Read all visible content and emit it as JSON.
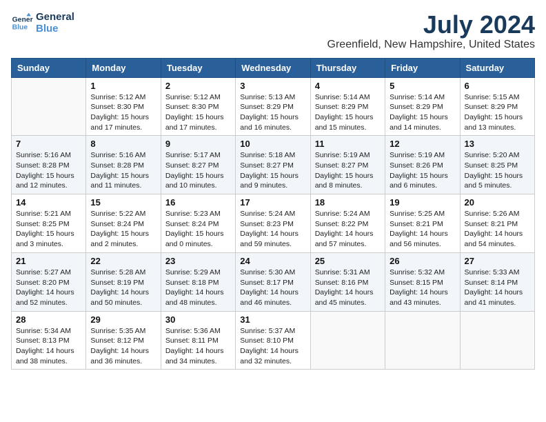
{
  "logo": {
    "line1": "General",
    "line2": "Blue"
  },
  "title": "July 2024",
  "subtitle": "Greenfield, New Hampshire, United States",
  "columns": [
    "Sunday",
    "Monday",
    "Tuesday",
    "Wednesday",
    "Thursday",
    "Friday",
    "Saturday"
  ],
  "weeks": [
    [
      {
        "day": "",
        "info": ""
      },
      {
        "day": "1",
        "info": "Sunrise: 5:12 AM\nSunset: 8:30 PM\nDaylight: 15 hours\nand 17 minutes."
      },
      {
        "day": "2",
        "info": "Sunrise: 5:12 AM\nSunset: 8:30 PM\nDaylight: 15 hours\nand 17 minutes."
      },
      {
        "day": "3",
        "info": "Sunrise: 5:13 AM\nSunset: 8:29 PM\nDaylight: 15 hours\nand 16 minutes."
      },
      {
        "day": "4",
        "info": "Sunrise: 5:14 AM\nSunset: 8:29 PM\nDaylight: 15 hours\nand 15 minutes."
      },
      {
        "day": "5",
        "info": "Sunrise: 5:14 AM\nSunset: 8:29 PM\nDaylight: 15 hours\nand 14 minutes."
      },
      {
        "day": "6",
        "info": "Sunrise: 5:15 AM\nSunset: 8:29 PM\nDaylight: 15 hours\nand 13 minutes."
      }
    ],
    [
      {
        "day": "7",
        "info": "Sunrise: 5:16 AM\nSunset: 8:28 PM\nDaylight: 15 hours\nand 12 minutes."
      },
      {
        "day": "8",
        "info": "Sunrise: 5:16 AM\nSunset: 8:28 PM\nDaylight: 15 hours\nand 11 minutes."
      },
      {
        "day": "9",
        "info": "Sunrise: 5:17 AM\nSunset: 8:27 PM\nDaylight: 15 hours\nand 10 minutes."
      },
      {
        "day": "10",
        "info": "Sunrise: 5:18 AM\nSunset: 8:27 PM\nDaylight: 15 hours\nand 9 minutes."
      },
      {
        "day": "11",
        "info": "Sunrise: 5:19 AM\nSunset: 8:27 PM\nDaylight: 15 hours\nand 8 minutes."
      },
      {
        "day": "12",
        "info": "Sunrise: 5:19 AM\nSunset: 8:26 PM\nDaylight: 15 hours\nand 6 minutes."
      },
      {
        "day": "13",
        "info": "Sunrise: 5:20 AM\nSunset: 8:25 PM\nDaylight: 15 hours\nand 5 minutes."
      }
    ],
    [
      {
        "day": "14",
        "info": "Sunrise: 5:21 AM\nSunset: 8:25 PM\nDaylight: 15 hours\nand 3 minutes."
      },
      {
        "day": "15",
        "info": "Sunrise: 5:22 AM\nSunset: 8:24 PM\nDaylight: 15 hours\nand 2 minutes."
      },
      {
        "day": "16",
        "info": "Sunrise: 5:23 AM\nSunset: 8:24 PM\nDaylight: 15 hours\nand 0 minutes."
      },
      {
        "day": "17",
        "info": "Sunrise: 5:24 AM\nSunset: 8:23 PM\nDaylight: 14 hours\nand 59 minutes."
      },
      {
        "day": "18",
        "info": "Sunrise: 5:24 AM\nSunset: 8:22 PM\nDaylight: 14 hours\nand 57 minutes."
      },
      {
        "day": "19",
        "info": "Sunrise: 5:25 AM\nSunset: 8:21 PM\nDaylight: 14 hours\nand 56 minutes."
      },
      {
        "day": "20",
        "info": "Sunrise: 5:26 AM\nSunset: 8:21 PM\nDaylight: 14 hours\nand 54 minutes."
      }
    ],
    [
      {
        "day": "21",
        "info": "Sunrise: 5:27 AM\nSunset: 8:20 PM\nDaylight: 14 hours\nand 52 minutes."
      },
      {
        "day": "22",
        "info": "Sunrise: 5:28 AM\nSunset: 8:19 PM\nDaylight: 14 hours\nand 50 minutes."
      },
      {
        "day": "23",
        "info": "Sunrise: 5:29 AM\nSunset: 8:18 PM\nDaylight: 14 hours\nand 48 minutes."
      },
      {
        "day": "24",
        "info": "Sunrise: 5:30 AM\nSunset: 8:17 PM\nDaylight: 14 hours\nand 46 minutes."
      },
      {
        "day": "25",
        "info": "Sunrise: 5:31 AM\nSunset: 8:16 PM\nDaylight: 14 hours\nand 45 minutes."
      },
      {
        "day": "26",
        "info": "Sunrise: 5:32 AM\nSunset: 8:15 PM\nDaylight: 14 hours\nand 43 minutes."
      },
      {
        "day": "27",
        "info": "Sunrise: 5:33 AM\nSunset: 8:14 PM\nDaylight: 14 hours\nand 41 minutes."
      }
    ],
    [
      {
        "day": "28",
        "info": "Sunrise: 5:34 AM\nSunset: 8:13 PM\nDaylight: 14 hours\nand 38 minutes."
      },
      {
        "day": "29",
        "info": "Sunrise: 5:35 AM\nSunset: 8:12 PM\nDaylight: 14 hours\nand 36 minutes."
      },
      {
        "day": "30",
        "info": "Sunrise: 5:36 AM\nSunset: 8:11 PM\nDaylight: 14 hours\nand 34 minutes."
      },
      {
        "day": "31",
        "info": "Sunrise: 5:37 AM\nSunset: 8:10 PM\nDaylight: 14 hours\nand 32 minutes."
      },
      {
        "day": "",
        "info": ""
      },
      {
        "day": "",
        "info": ""
      },
      {
        "day": "",
        "info": ""
      }
    ]
  ]
}
